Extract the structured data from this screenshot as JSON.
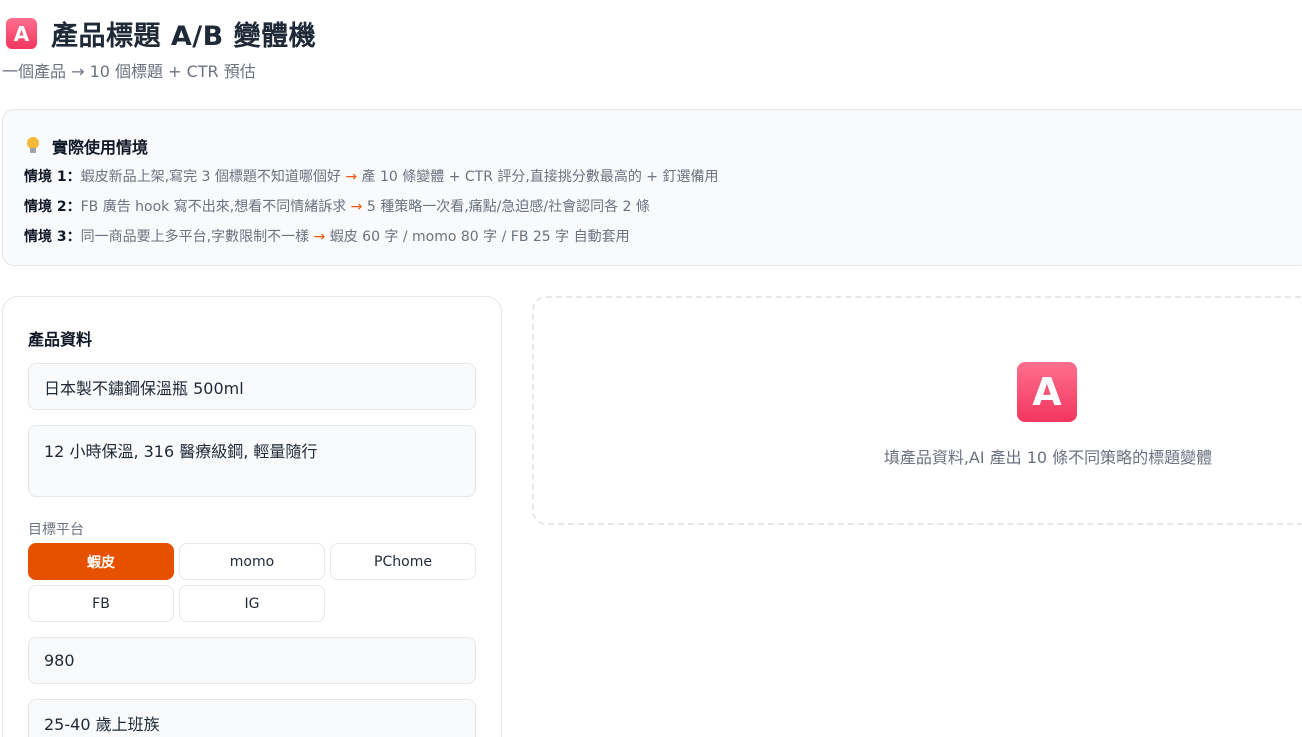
{
  "header": {
    "icon": "A-button-emoji",
    "icon_glyph": "A",
    "title": "產品標題 A/B 變體機",
    "subtitle": "一個產品 → 10 個標題 + CTR 預估"
  },
  "scenarios": {
    "title": "實際使用情境",
    "icon": "lightbulb-icon",
    "items": [
      {
        "label": "情境 1：",
        "before": "蝦皮新品上架,寫完 3 個標題不知道哪個好 ",
        "arrow": "→",
        "after": " 產 10 條變體 + CTR 評分,直接挑分數最高的 + 釘選備用"
      },
      {
        "label": "情境 2：",
        "before": "FB 廣告 hook 寫不出來,想看不同情緒訴求 ",
        "arrow": "→",
        "after": " 5 種策略一次看,痛點/急迫感/社會認同各 2 條"
      },
      {
        "label": "情境 3：",
        "before": "同一商品要上多平台,字數限制不一樣 ",
        "arrow": "→",
        "after": " 蝦皮 60 字 / momo 80 字 / FB 25 字 自動套用"
      }
    ]
  },
  "form": {
    "title": "產品資料",
    "product_name": "日本製不鏽鋼保溫瓶 500ml",
    "features": "12 小時保溫, 316 醫療級鋼, 輕量隨行",
    "platform_label": "目標平台",
    "platforms": [
      "蝦皮",
      "momo",
      "PChome",
      "FB",
      "IG"
    ],
    "selected_platform": "蝦皮",
    "price": "980",
    "audience": "25-40 歲上班族"
  },
  "result": {
    "icon": "A-button-emoji",
    "icon_glyph": "A",
    "empty_text": "填產品資料,AI 產出 10 條不同策略的標題變體"
  },
  "colors": {
    "accent": "#e65100",
    "arrow": "#ea580c",
    "emoji_pink": "#f2365f"
  }
}
